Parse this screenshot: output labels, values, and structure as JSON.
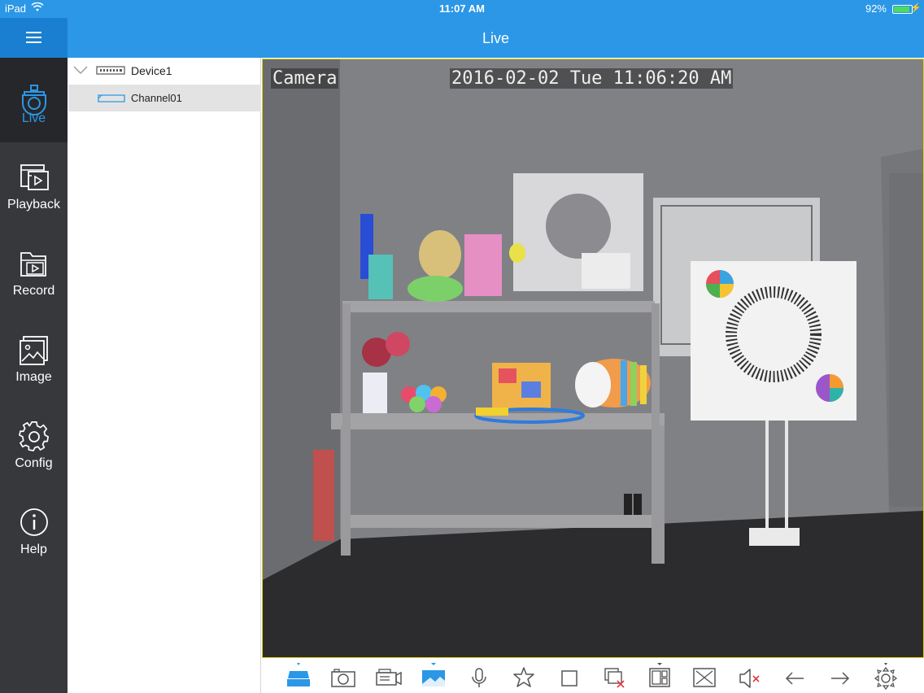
{
  "status_bar": {
    "carrier": "iPad",
    "time": "11:07 AM",
    "battery": "92%"
  },
  "header": {
    "title": "Live"
  },
  "nav": {
    "items": [
      {
        "label": "Live",
        "icon": "camera-icon",
        "active": true
      },
      {
        "label": "Playback",
        "icon": "playback-icon"
      },
      {
        "label": "Record",
        "icon": "record-folder-icon"
      },
      {
        "label": "Image",
        "icon": "image-icon"
      },
      {
        "label": "Config",
        "icon": "gear-icon"
      },
      {
        "label": "Help",
        "icon": "info-icon"
      }
    ]
  },
  "tree": {
    "device": {
      "label": "Device1",
      "icon": "dvr-icon"
    },
    "channel": {
      "label": "Channel01",
      "icon": "channel-icon"
    }
  },
  "video": {
    "osd_name": "Camera",
    "osd_timestamp": "2016-02-02 Tue 11:06:20 AM"
  },
  "toolbar": {
    "icons": [
      "stream-icon",
      "snapshot-icon",
      "record-video-icon",
      "image-quality-icon",
      "microphone-icon",
      "favorite-icon",
      "stop-icon",
      "close-all-icon",
      "layout-icon",
      "fullscreen-icon",
      "mute-icon",
      "previous-icon",
      "next-icon",
      "ptz-icon"
    ]
  },
  "colors": {
    "accent": "#2b97e6",
    "nav_bg": "#37383b",
    "video_border": "#e4d21a"
  }
}
